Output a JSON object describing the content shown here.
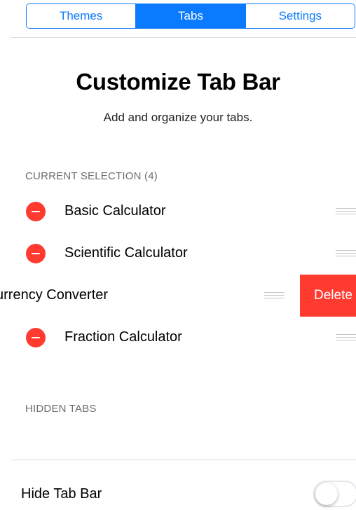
{
  "segmented_control": {
    "segments": [
      {
        "label": "Themes",
        "selected": false
      },
      {
        "label": "Tabs",
        "selected": true
      },
      {
        "label": "Settings",
        "selected": false
      }
    ]
  },
  "header": {
    "title": "Customize Tab Bar",
    "subtitle": "Add and organize your tabs."
  },
  "current_selection": {
    "header": "CURRENT SELECTION (4)",
    "items": [
      {
        "label": "Basic Calculator",
        "swiped": false
      },
      {
        "label": "Scientific Calculator",
        "swiped": false
      },
      {
        "label": "urrency Converter",
        "swiped": true
      },
      {
        "label": "Fraction Calculator",
        "swiped": false
      }
    ],
    "delete_label": "Delete"
  },
  "hidden_tabs": {
    "header": "HIDDEN TABS"
  },
  "settings": {
    "hide_tab_bar_label": "Hide Tab Bar",
    "hide_tab_bar_on": false
  },
  "colors": {
    "accent": "#0a7aff",
    "destructive": "#ff3b30"
  },
  "icons": {
    "remove": "minus-circle-icon",
    "reorder": "reorder-grip-icon"
  }
}
